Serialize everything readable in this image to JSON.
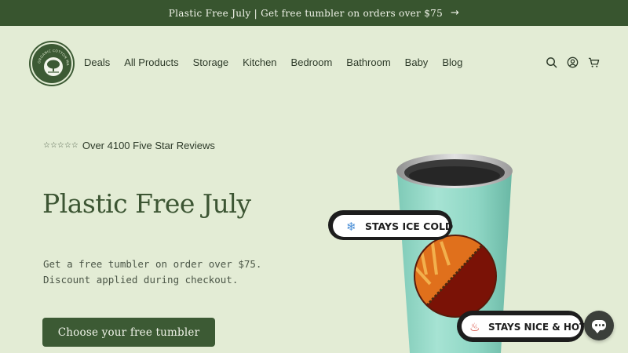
{
  "announcement": {
    "text": "Plastic Free July | Get free tumbler on orders over $75",
    "arrow_icon": "arrow-right-icon"
  },
  "brand": {
    "logo_text": "ORGANIC COTTON MART",
    "logo_icon": "tree-logo-icon"
  },
  "nav": {
    "items": [
      {
        "label": "Deals"
      },
      {
        "label": "All Products"
      },
      {
        "label": "Storage"
      },
      {
        "label": "Kitchen"
      },
      {
        "label": "Bedroom"
      },
      {
        "label": "Bathroom"
      },
      {
        "label": "Baby"
      },
      {
        "label": "Blog"
      }
    ]
  },
  "header_icons": [
    "search-icon",
    "account-icon",
    "cart-icon"
  ],
  "hero": {
    "stars": "☆☆☆☆☆",
    "reviews_text": "Over 4100 Five Star Reviews",
    "title": "Plastic Free July",
    "subtitle": "Get a free tumbler on order over $75. Discount applied during checkout.",
    "cta_label": "Choose your free tumbler"
  },
  "product": {
    "badge_cold": "STAYS ICE COLD",
    "badge_hot": "STAYS NICE & HOT",
    "tumbler_color": "#8ed6c4"
  },
  "colors": {
    "background": "#e3ecd5",
    "brand_green": "#3c5a34",
    "announcement_bg": "#38552f"
  },
  "chat": {
    "icon": "chat-bubble-icon"
  }
}
